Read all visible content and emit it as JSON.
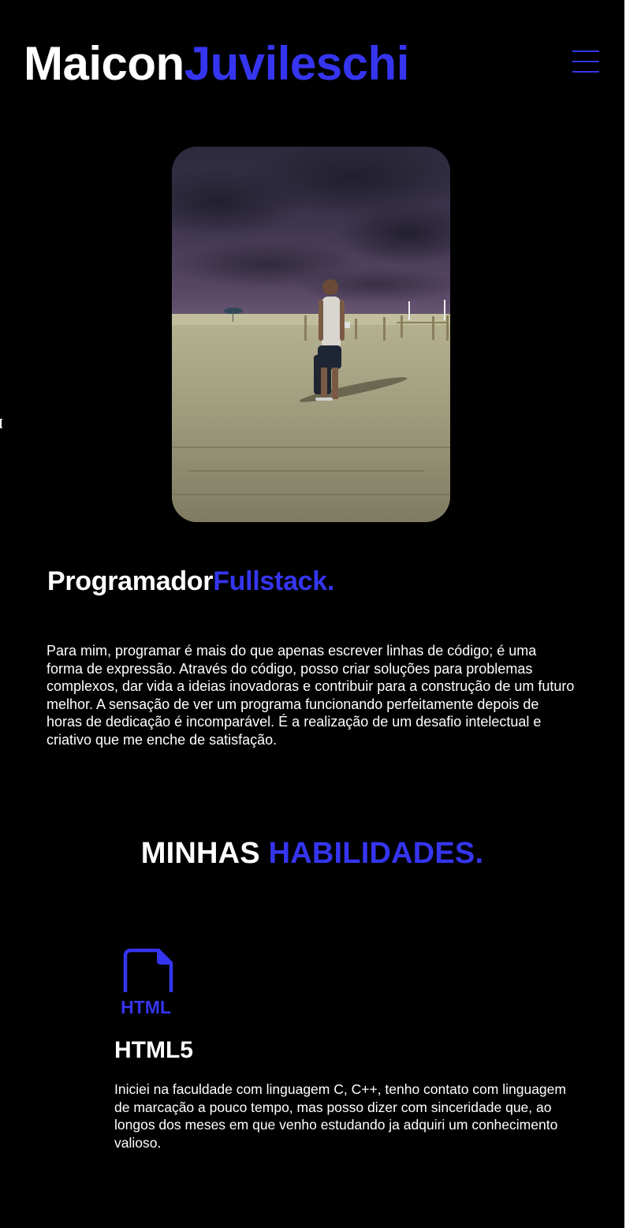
{
  "header": {
    "logo_first": "Maicon",
    "logo_last": "Juvileschi",
    "menu_icon": "hamburger-menu-icon"
  },
  "hero": {
    "photo_icon": "profile-photo-beach-night"
  },
  "intro": {
    "role_first": "Programador",
    "role_last": "Fullstack.",
    "about": "Para mim, programar é mais do que apenas escrever linhas de código; é uma forma de expressão. Através do código, posso criar soluções para problemas complexos, dar vida a ideias inovadoras e contribuir para a construção de um futuro melhor. A sensação de ver um programa funcionando perfeitamente depois de horas de dedicação é incomparável. É a realização de um desafio intelectual e criativo que me enche de satisfação."
  },
  "skills": {
    "title_first": "MINHAS",
    "title_last": "HABILIDADES.",
    "items": [
      {
        "icon": "html-file-icon",
        "icon_label": "HTML",
        "name": "HTML5",
        "description": "Iniciei na faculdade com linguagem C, C++, tenho contato com linguagem de marcação a pouco tempo, mas posso dizer com sinceridade que, ao longos dos meses em que venho estudando ja adquiri um conhecimento valioso."
      }
    ]
  },
  "colors": {
    "background": "#000000",
    "text": "#ffffff",
    "accent": "#3535f0"
  }
}
